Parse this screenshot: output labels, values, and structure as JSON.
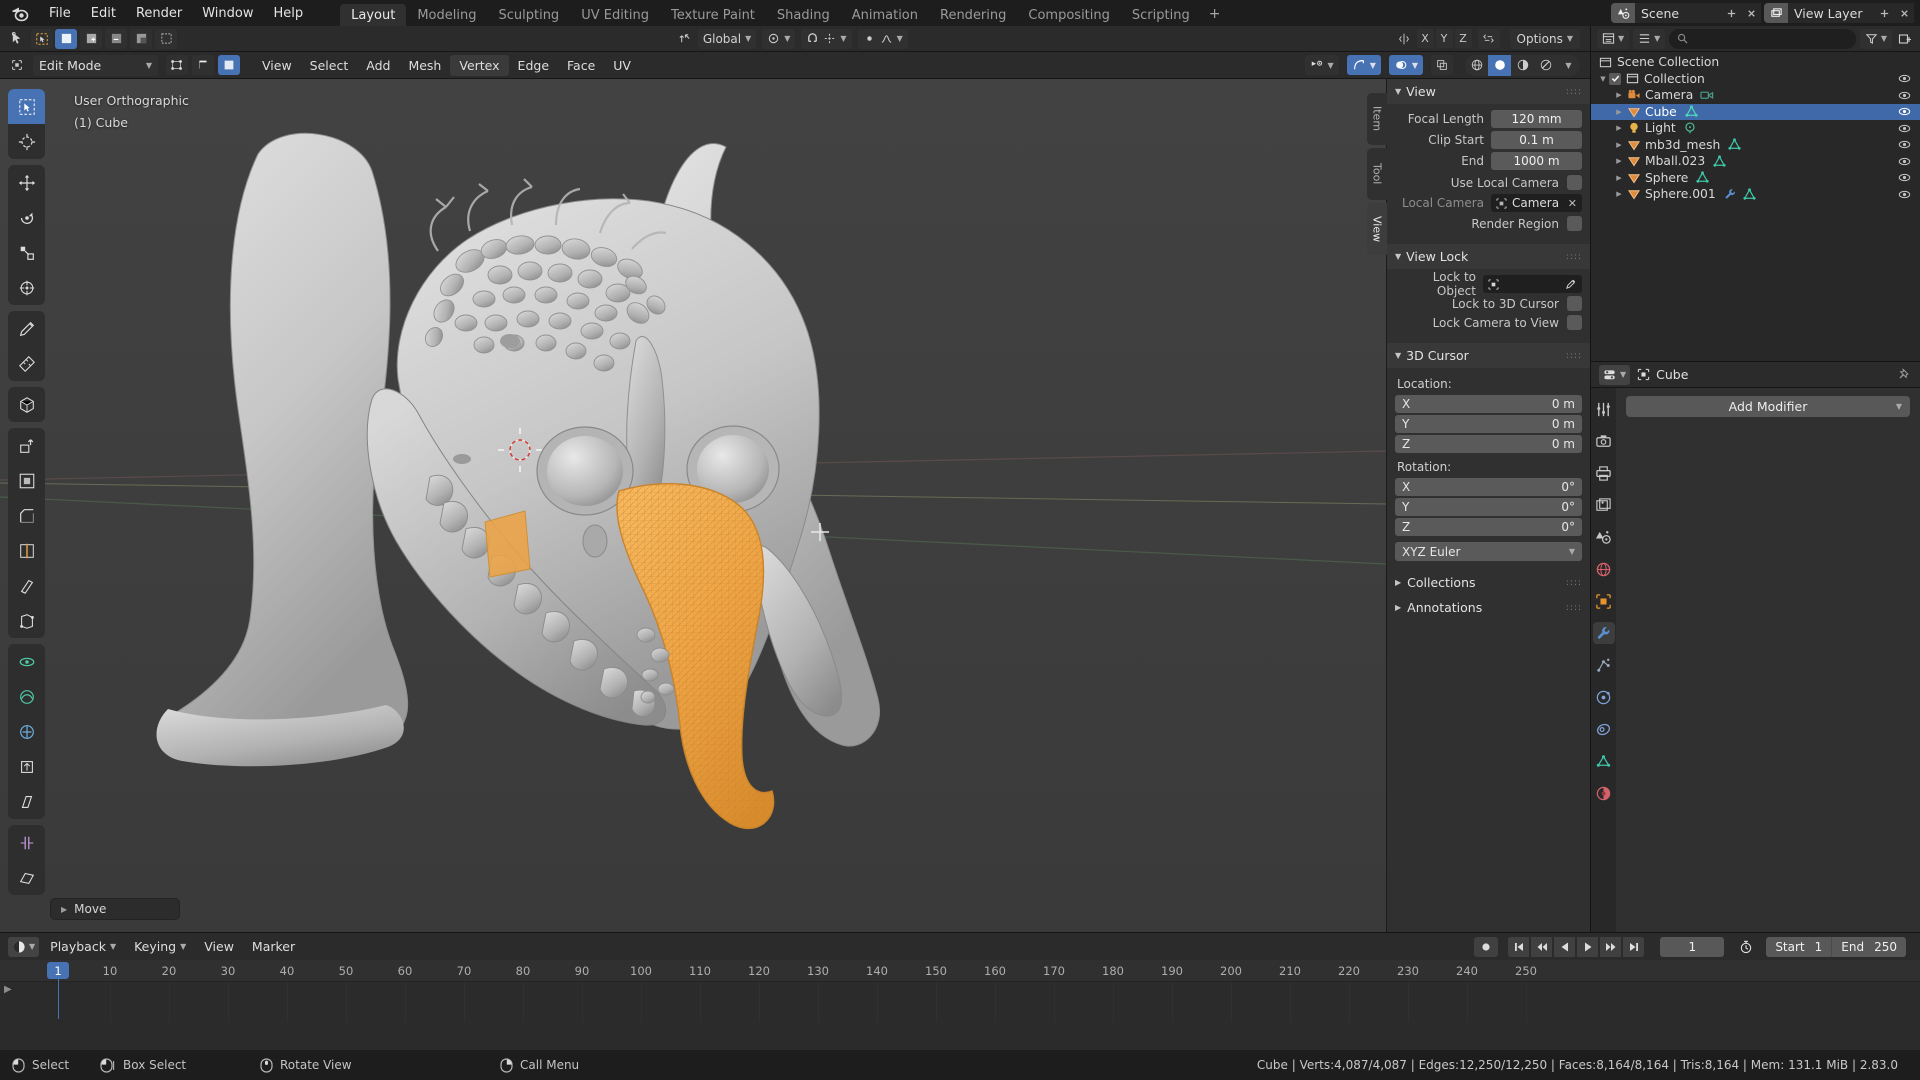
{
  "app": {
    "version": "2.83.0",
    "accent": "#4772b3",
    "bg": "#303030"
  },
  "topbar": {
    "logo_icon": "blender-logo-icon",
    "menus": [
      "File",
      "Edit",
      "Render",
      "Window",
      "Help"
    ],
    "workspace_tabs": [
      {
        "label": "Layout",
        "active": true
      },
      {
        "label": "Modeling",
        "active": false
      },
      {
        "label": "Sculpting",
        "active": false
      },
      {
        "label": "UV Editing",
        "active": false
      },
      {
        "label": "Texture Paint",
        "active": false
      },
      {
        "label": "Shading",
        "active": false
      },
      {
        "label": "Animation",
        "active": false
      },
      {
        "label": "Rendering",
        "active": false
      },
      {
        "label": "Compositing",
        "active": false
      },
      {
        "label": "Scripting",
        "active": false
      }
    ],
    "add_workspace_label": "+",
    "scene": {
      "icon": "scene-icon",
      "name": "Scene",
      "new_label": "",
      "unlink_label": ""
    },
    "view_layer": {
      "icon": "view-layer-icon",
      "name": "View Layer"
    }
  },
  "viewport_tool_header": {
    "mode_icon": "cursor-tool-icon",
    "transform_pivot_icon": "pivot-icon",
    "snap_icon": "magnet-icon",
    "proportional_icon": "proportional-edit-icon",
    "orientation": "Global",
    "xyz": [
      "X",
      "Y",
      "Z"
    ],
    "options_label": "Options",
    "mirror_icon": "mirror-icon"
  },
  "viewport_header": {
    "mode": "Edit Mode",
    "select_modes": [
      "vertex-select-icon",
      "edge-select-icon",
      "face-select-icon"
    ],
    "select_mode_active_index": 2,
    "menus": [
      "View",
      "Select",
      "Add",
      "Mesh",
      "Vertex",
      "Edge",
      "Face",
      "UV"
    ],
    "active_menu": "Vertex",
    "shading_modes": [
      "wireframe-icon",
      "solid-icon",
      "material-preview-icon",
      "rendered-icon"
    ],
    "shading_active_index": 1,
    "visibility_icon": "show-gizmo-icon",
    "overlays_icon": "overlays-icon",
    "xray_icon": "xray-icon"
  },
  "viewport": {
    "view_label": "User Orthographic",
    "object_label": "(1) Cube",
    "tools": [
      "tweak-select-box-icon",
      "cursor-icon",
      "move-icon",
      "rotate-icon",
      "scale-icon",
      "transform-icon",
      "annotate-icon",
      "measure-icon",
      "add-cube-icon",
      "extrude-region-icon",
      "inset-faces-icon",
      "bevel-icon",
      "loop-cut-icon",
      "knife-icon",
      "poly-build-icon",
      "spin-icon",
      "smooth-icon",
      "edge-slide-icon",
      "shrink-fatten-icon",
      "shear-icon",
      "rip-region-icon"
    ],
    "active_tool_index": 0,
    "gizmo_axes": [
      "X",
      "Y",
      "Z"
    ],
    "nav_buttons": [
      "zoom-icon",
      "pan-hand-icon",
      "camera-view-icon",
      "toggle-ortho-icon"
    ],
    "operator_panel": {
      "label": "Move",
      "expand_icon": "triangle-right-icon"
    }
  },
  "n_panel": {
    "tabs": [
      {
        "label": "Item",
        "active": false
      },
      {
        "label": "Tool",
        "active": false
      },
      {
        "label": "View",
        "active": true
      }
    ],
    "sections": [
      {
        "title": "View",
        "open": true,
        "fields": [
          {
            "label": "Focal Length",
            "value": "120 mm"
          },
          {
            "label": "Clip Start",
            "value": "0.1 m"
          },
          {
            "label": "End",
            "value": "1000 m"
          }
        ],
        "checks": [
          {
            "label": "Use Local Camera",
            "checked": false
          },
          {
            "label": "Render Region",
            "checked": false
          }
        ],
        "local_camera": {
          "label": "Local Camera",
          "value": "Camera",
          "icon": "object-icon",
          "clear_icon": "x-icon"
        }
      },
      {
        "title": "View Lock",
        "open": true,
        "lock_to_object": {
          "label": "Lock to Object",
          "value": "",
          "icon": "object-icon",
          "eyedropper_icon": "eyedropper-icon"
        },
        "checks": [
          {
            "label": "Lock to 3D Cursor",
            "checked": false
          },
          {
            "label": "Lock Camera to View",
            "checked": false
          }
        ]
      },
      {
        "title": "3D Cursor",
        "open": true,
        "location_label": "Location:",
        "location": [
          {
            "axis": "X",
            "value": "0 m"
          },
          {
            "axis": "Y",
            "value": "0 m"
          },
          {
            "axis": "Z",
            "value": "0 m"
          }
        ],
        "rotation_label": "Rotation:",
        "rotation": [
          {
            "axis": "X",
            "value": "0°"
          },
          {
            "axis": "Y",
            "value": "0°"
          },
          {
            "axis": "Z",
            "value": "0°"
          }
        ],
        "rotation_mode": "XYZ Euler"
      },
      {
        "title": "Collections",
        "open": false
      },
      {
        "title": "Annotations",
        "open": false
      }
    ]
  },
  "outliner": {
    "display_mode_icon": "outliner-icon",
    "filter_icon": "filter-icon",
    "search_placeholder": "",
    "search_icon": "search-icon",
    "root": {
      "label": "Scene Collection",
      "icon": "scene-collection-icon"
    },
    "rows": [
      {
        "indent": 0,
        "label": "Collection",
        "icon": "collection-icon",
        "icon_color": "#d0d0d0",
        "tri": "▼",
        "checkbox": true,
        "selected": false,
        "badges": [],
        "eye": true
      },
      {
        "indent": 1,
        "label": "Camera",
        "icon": "camera-icon",
        "icon_color": "#e08a3c",
        "tri": "▶",
        "checkbox": false,
        "selected": false,
        "badges": [
          "camera-data-icon"
        ],
        "badge_colors": [
          "#4a9a86"
        ],
        "eye": true
      },
      {
        "indent": 1,
        "label": "Cube",
        "icon": "mesh-icon",
        "icon_color": "#e08a3c",
        "tri": "▶",
        "checkbox": false,
        "selected": true,
        "badges": [
          "mesh-data-icon"
        ],
        "badge_colors": [
          "#3ec8a8"
        ],
        "eye": true
      },
      {
        "indent": 1,
        "label": "Light",
        "icon": "light-icon",
        "icon_color": "#e0b03c",
        "tri": "▶",
        "checkbox": false,
        "selected": false,
        "badges": [
          "light-data-icon"
        ],
        "badge_colors": [
          "#4ba88a"
        ],
        "eye": true
      },
      {
        "indent": 1,
        "label": "mb3d_mesh",
        "icon": "mesh-icon",
        "icon_color": "#e08a3c",
        "tri": "▶",
        "checkbox": false,
        "selected": false,
        "badges": [
          "mesh-data-icon"
        ],
        "badge_colors": [
          "#3ec8a8"
        ],
        "eye": true
      },
      {
        "indent": 1,
        "label": "Mball.023",
        "icon": "mesh-icon",
        "icon_color": "#e08a3c",
        "tri": "▶",
        "checkbox": false,
        "selected": false,
        "badges": [
          "mesh-data-icon"
        ],
        "badge_colors": [
          "#3ec8a8"
        ],
        "eye": true
      },
      {
        "indent": 1,
        "label": "Sphere",
        "icon": "mesh-icon",
        "icon_color": "#e08a3c",
        "tri": "▶",
        "checkbox": false,
        "selected": false,
        "badges": [
          "mesh-data-icon"
        ],
        "badge_colors": [
          "#3ec8a8"
        ],
        "eye": true
      },
      {
        "indent": 1,
        "label": "Sphere.001",
        "icon": "mesh-icon",
        "icon_color": "#e08a3c",
        "tri": "▶",
        "checkbox": false,
        "selected": false,
        "badges": [
          "modifier-icon",
          "mesh-data-icon"
        ],
        "badge_colors": [
          "#5a8fd0",
          "#3ec8a8"
        ],
        "eye": true
      }
    ]
  },
  "properties": {
    "editor_icon": "properties-editor-icon",
    "breadcrumb_icon": "object-icon",
    "breadcrumb": "Cube",
    "pin_icon": "pin-icon",
    "tabs": [
      {
        "name": "tool-tab",
        "icon": "tool-icon",
        "active": false,
        "color": "#c8c8c8"
      },
      {
        "name": "render-tab",
        "icon": "render-camera-icon",
        "active": false,
        "color": "#c8c8c8"
      },
      {
        "name": "output-tab",
        "icon": "printer-icon",
        "active": false,
        "color": "#c8c8c8"
      },
      {
        "name": "view-layer-tab",
        "icon": "images-icon",
        "active": false,
        "color": "#c8c8c8"
      },
      {
        "name": "scene-tab",
        "icon": "scene-icon",
        "active": false,
        "color": "#c8c8c8"
      },
      {
        "name": "world-tab",
        "icon": "world-icon",
        "active": false,
        "color": "#d4626a"
      },
      {
        "name": "object-tab",
        "icon": "object-square-icon",
        "active": false,
        "color": "#e8932c"
      },
      {
        "name": "modifier-tab",
        "icon": "wrench-icon",
        "active": true,
        "color": "#5a8fd0"
      },
      {
        "name": "particles-tab",
        "icon": "particles-icon",
        "active": false,
        "color": "#9aa8bc"
      },
      {
        "name": "physics-tab",
        "icon": "physics-icon",
        "active": false,
        "color": "#7fa3d8"
      },
      {
        "name": "constraints-tab",
        "icon": "constraint-icon",
        "active": false,
        "color": "#7fa3d8"
      },
      {
        "name": "data-tab",
        "icon": "mesh-data-icon",
        "active": false,
        "color": "#3ec8a8"
      },
      {
        "name": "material-tab",
        "icon": "material-sphere-icon",
        "active": false,
        "color": "#d4626a"
      }
    ],
    "add_modifier_label": "Add Modifier",
    "add_modifier_caret": "chevron-down-icon"
  },
  "timeline": {
    "editor_icon": "timeline-editor-icon",
    "menus": [
      {
        "label": "Playback",
        "dropdown": true
      },
      {
        "label": "Keying",
        "dropdown": true
      },
      {
        "label": "View",
        "dropdown": false
      },
      {
        "label": "Marker",
        "dropdown": false
      }
    ],
    "record_icon": "record-icon",
    "transport": [
      "jump-to-start-icon",
      "prev-keyframe-icon",
      "play-reverse-icon",
      "play-icon",
      "next-keyframe-icon",
      "jump-to-end-icon"
    ],
    "current_frame": "1",
    "timer_icon": "stopwatch-icon",
    "start_label": "Start",
    "start_value": "1",
    "end_label": "End",
    "end_value": "250",
    "ruler_ticks": [
      "10",
      "20",
      "30",
      "40",
      "50",
      "60",
      "70",
      "80",
      "90",
      "100",
      "110",
      "120",
      "130",
      "140",
      "150",
      "160",
      "170",
      "180",
      "190",
      "200",
      "210",
      "220",
      "230",
      "240",
      "250"
    ],
    "playhead_label": "1"
  },
  "statusbar": {
    "hints": [
      {
        "icon": "mouse-left-icon",
        "label": "Select"
      },
      {
        "icon": "mouse-left-drag-icon",
        "label": "Box Select"
      },
      {
        "icon": "mouse-middle-icon",
        "label": "Rotate View"
      },
      {
        "icon": "mouse-right-icon",
        "label": "Call Menu"
      }
    ],
    "stats": "Cube | Verts:4,087/4,087 | Edges:12,250/12,250 | Faces:8,164/8,164 | Tris:8,164 | Mem: 131.1 MiB | 2.83.0"
  }
}
